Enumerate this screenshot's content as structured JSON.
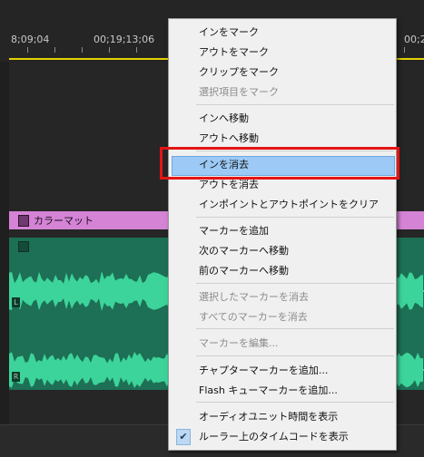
{
  "timeline": {
    "ruler": {
      "labels": [
        "8;09;04",
        "00;19;13;06",
        "00;2"
      ]
    },
    "video_clip": {
      "label": "カラーマット",
      "color": "#d483d5"
    },
    "audio_clip": {
      "color": "#1d6f55",
      "waveform_color": "#3cd49a",
      "left_channel": "L",
      "right_channel": "R"
    }
  },
  "context_menu": {
    "items": [
      {
        "label": "インをマーク",
        "enabled": true
      },
      {
        "label": "アウトをマーク",
        "enabled": true
      },
      {
        "label": "クリップをマーク",
        "enabled": true
      },
      {
        "label": "選択項目をマーク",
        "enabled": false
      },
      {
        "label": "インへ移動",
        "enabled": true
      },
      {
        "label": "アウトへ移動",
        "enabled": true
      },
      {
        "label": "インを消去",
        "enabled": true,
        "highlighted": true
      },
      {
        "label": "アウトを消去",
        "enabled": true
      },
      {
        "label": "インポイントとアウトポイントをクリア",
        "enabled": true
      },
      {
        "label": "マーカーを追加",
        "enabled": true
      },
      {
        "label": "次のマーカーへ移動",
        "enabled": true
      },
      {
        "label": "前のマーカーへ移動",
        "enabled": true
      },
      {
        "label": "選択したマーカーを消去",
        "enabled": false
      },
      {
        "label": "すべてのマーカーを消去",
        "enabled": false
      },
      {
        "label": "マーカーを編集...",
        "enabled": false
      },
      {
        "label": "チャプターマーカーを追加...",
        "enabled": true
      },
      {
        "label": "Flash キューマーカーを追加...",
        "enabled": true
      },
      {
        "label": "オーディオユニット時間を表示",
        "enabled": true
      },
      {
        "label": "ルーラー上のタイムコードを表示",
        "enabled": true,
        "checked": true
      }
    ]
  },
  "annotation": {
    "color": "#e41414",
    "target": "インを消去"
  }
}
